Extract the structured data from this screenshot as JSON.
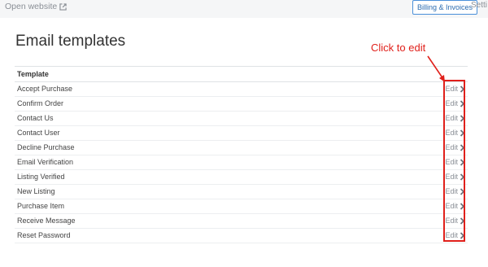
{
  "topbar": {
    "open_website_label": "Open website",
    "billing_label": "Billing & Invoices",
    "settings_label": "Setti"
  },
  "page": {
    "title": "Email templates"
  },
  "table": {
    "header": "Template",
    "edit_label": "Edit",
    "rows": [
      "Accept Purchase",
      "Confirm Order",
      "Contact Us",
      "Contact User",
      "Decline Purchase",
      "Email Verification",
      "Listing Verified",
      "New Listing",
      "Purchase Item",
      "Receive Message",
      "Reset Password"
    ]
  },
  "annotation": {
    "text": "Click to edit",
    "color": "#e0201b"
  },
  "icons": {
    "external_link": "external-link-icon",
    "chevron": "chevron-right-icon"
  }
}
